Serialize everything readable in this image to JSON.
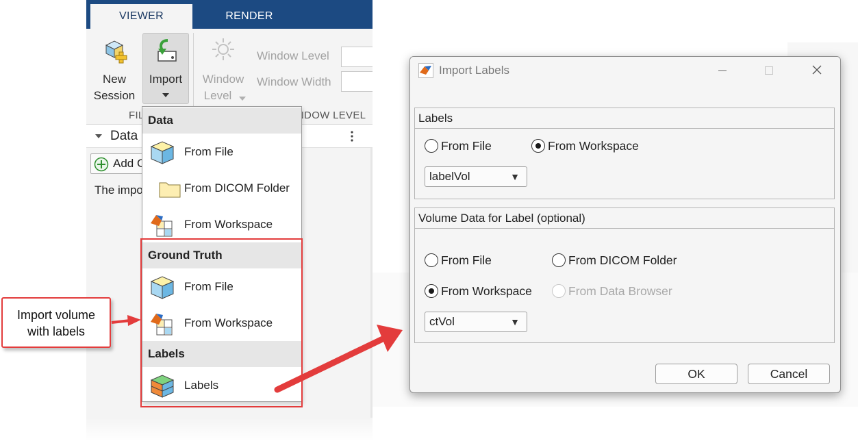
{
  "app": {
    "tabs": [
      {
        "label": "VIEWER"
      },
      {
        "label": "RENDER"
      }
    ],
    "toolbar": {
      "new_session": {
        "line1": "New",
        "line2": "Session"
      },
      "import": {
        "label": "Import"
      },
      "window_level_btn": {
        "line1": "Window",
        "line2": "Level"
      },
      "window_level_field": "Window Level",
      "window_width_field": "Window Width",
      "section_file": "FILE",
      "section_window_level": "WINDOW LEVEL"
    },
    "data_panel": {
      "title": "Data",
      "add_button": "Add Group",
      "message": "The imported data appears here"
    }
  },
  "menu": {
    "sections": [
      {
        "title": "Data",
        "items": [
          {
            "label": "From File",
            "icon": "cube-volume-icon"
          },
          {
            "label": "From DICOM Folder",
            "icon": "folder-icon"
          },
          {
            "label": "From Workspace",
            "icon": "matlab-workspace-icon"
          }
        ]
      },
      {
        "title": "Ground Truth",
        "items": [
          {
            "label": "From File",
            "icon": "cube-volume-icon"
          },
          {
            "label": "From Workspace",
            "icon": "matlab-workspace-icon"
          }
        ]
      },
      {
        "title": "Labels",
        "items": [
          {
            "label": "Labels",
            "icon": "labels-cube-icon"
          }
        ]
      }
    ]
  },
  "callout": {
    "line1": "Import volume",
    "line2": "with labels"
  },
  "dialog": {
    "title": "Import Labels",
    "labels_group": {
      "title": "Labels",
      "options": [
        {
          "label": "From File",
          "selected": false
        },
        {
          "label": "From Workspace",
          "selected": true
        }
      ],
      "combo_value": "labelVol"
    },
    "volume_group": {
      "title": "Volume Data for Label (optional)",
      "options": [
        {
          "label": "From File",
          "selected": false,
          "enabled": true
        },
        {
          "label": "From DICOM Folder",
          "selected": false,
          "enabled": true
        },
        {
          "label": "From Workspace",
          "selected": true,
          "enabled": true
        },
        {
          "label": "From Data Browser",
          "selected": false,
          "enabled": false
        }
      ],
      "combo_value": "ctVol"
    },
    "ok_label": "OK",
    "cancel_label": "Cancel"
  },
  "colors": {
    "tab_bar": "#1c4a82",
    "highlight_red": "#e33c3c",
    "menu_header": "#e6e6e6"
  }
}
